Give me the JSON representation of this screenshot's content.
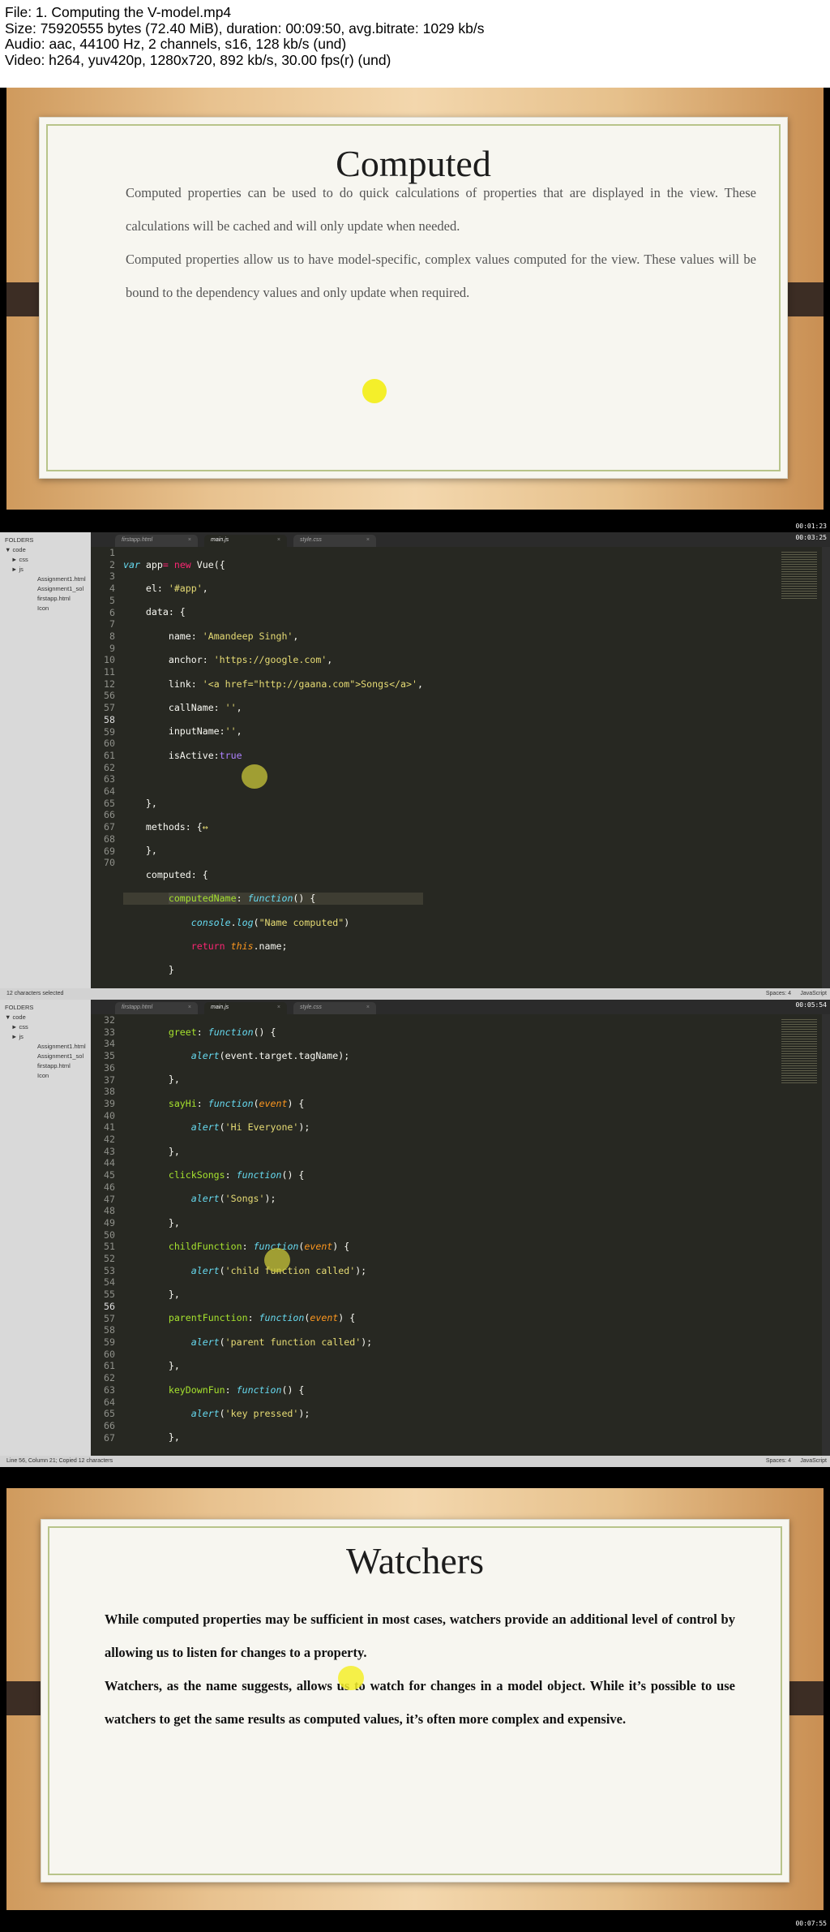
{
  "header": {
    "line1": "File: 1. Computing the V-model.mp4",
    "line2": "Size: 75920555 bytes (72.40 MiB), duration: 00:09:50, avg.bitrate: 1029 kb/s",
    "line3": "Audio: aac, 44100 Hz, 2 channels, s16, 128 kb/s (und)",
    "line4": "Video: h264, yuv420p, 1280x720, 892 kb/s, 30.00 fps(r) (und)"
  },
  "frame1": {
    "title": "Computed",
    "para1": "Computed properties can be used to do quick calculations of properties that are displayed in the view. These calculations will be cached and will only update when needed.",
    "para2": "Computed properties allow us to have model-specific, complex values computed for the view. These values will be bound to the dependency values and only update when required.",
    "timestamp": "00:01:23"
  },
  "editor_tabs": {
    "tab1": "firstapp.html",
    "tab2": "main.js",
    "tab3": "style.css",
    "close": "×"
  },
  "sidebar": {
    "folders": "FOLDERS",
    "code": "▼ code",
    "css": "► css",
    "js": "► js",
    "f1": "Assignment1.html",
    "f2": "Assignment1_sol",
    "f3": "firstapp.html",
    "f4": "Icon"
  },
  "frame2": {
    "status_left": "12 characters selected",
    "status_spaces": "Spaces: 4",
    "status_lang": "JavaScript",
    "timestamp": "00:03:25"
  },
  "frame3": {
    "status_left": "Line 56, Column 21; Copied 12 characters",
    "status_spaces": "Spaces: 4",
    "status_lang": "JavaScript",
    "timestamp": "00:05:54"
  },
  "frame4": {
    "title": "Watchers",
    "para1": "While computed properties may be sufficient in most cases, watchers provide an additional level of control by allowing us to listen for changes to a property.",
    "para2": "Watchers, as the name suggests, allows us to watch for changes in a model object. While it’s possible to use watchers to get the same results as computed values, it’s often more complex and expensive.",
    "timestamp": "00:07:55"
  },
  "colors": {
    "keyword": "#66d9ef",
    "string": "#e6db74",
    "function": "#a6e22e",
    "constant": "#ae81ff",
    "tag": "#f92672",
    "argument": "#fd971f",
    "background": "#272822"
  }
}
